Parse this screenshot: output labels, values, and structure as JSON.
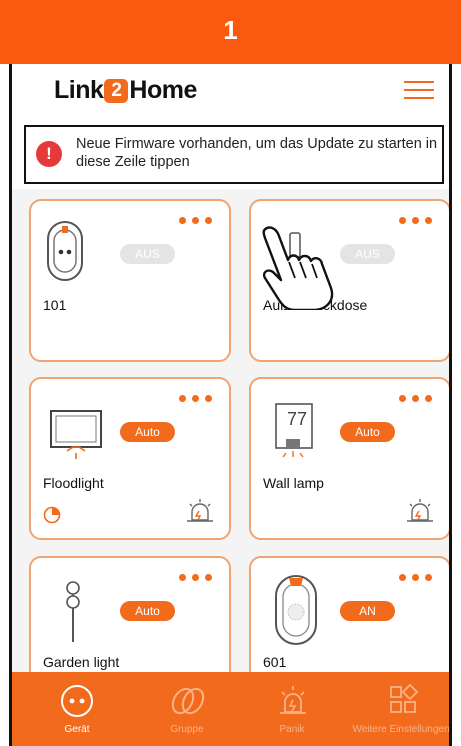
{
  "banner": {
    "step_number": "1"
  },
  "header": {
    "logo": {
      "part1": "Link",
      "part2": "2",
      "part3": "Home"
    }
  },
  "firmware_notice": {
    "text": "Neue Firmware vorhanden, um das Update zu starten in diese Zeile tippen"
  },
  "devices": [
    {
      "name": "101",
      "state": "AUS",
      "state_on": false
    },
    {
      "name": "Außensteckdose",
      "state": "AUS",
      "state_on": false
    },
    {
      "name": "Floodlight",
      "state": "Auto",
      "state_on": true
    },
    {
      "name": "Wall lamp",
      "state": "Auto",
      "state_on": true,
      "display_value": "77"
    },
    {
      "name": "Garden light",
      "state": "Auto",
      "state_on": true
    },
    {
      "name": "601",
      "state": "AN",
      "state_on": true
    }
  ],
  "bottom_nav": [
    {
      "label": "Gerät",
      "active": true,
      "icon": "plug-icon"
    },
    {
      "label": "Gruppe",
      "active": false,
      "icon": "group-rings-icon"
    },
    {
      "label": "Panik",
      "active": false,
      "icon": "alarm-siren-icon"
    },
    {
      "label": "Weitere Einstellungen",
      "active": false,
      "icon": "apps-grid-icon"
    }
  ],
  "colors": {
    "accent": "#f26a1b",
    "banner": "#fa5a0f",
    "card_border": "#f0a472",
    "toggle_off": "#e4e4e4",
    "alert": "#e43a3a"
  }
}
